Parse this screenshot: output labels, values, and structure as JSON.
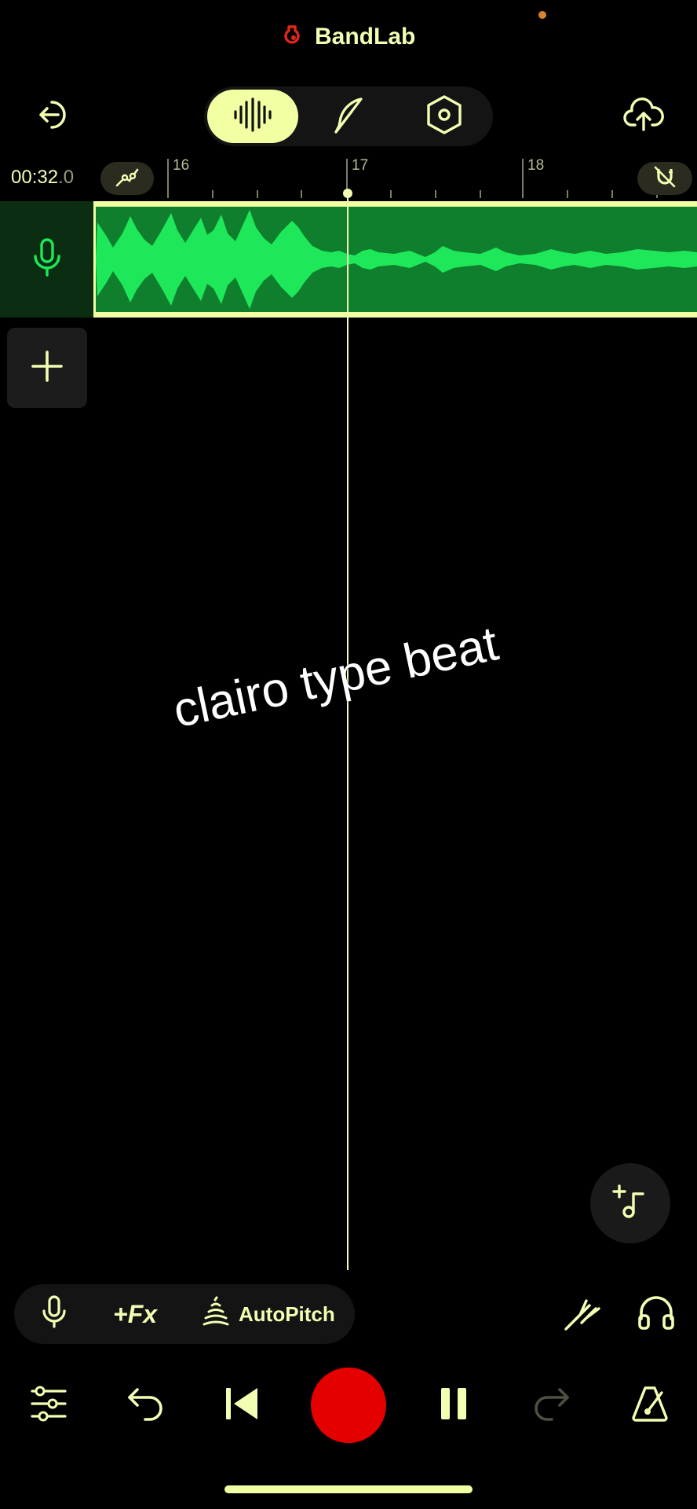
{
  "app": {
    "brand_name": "BandLab",
    "brand_color": "#e0261b"
  },
  "header": {
    "back_icon": "exit-icon",
    "modes": [
      {
        "name": "waveform-mode-icon",
        "active": true
      },
      {
        "name": "quill-mode-icon",
        "active": false
      },
      {
        "name": "settings-hex-icon",
        "active": false
      }
    ],
    "upload_icon": "cloud-upload-icon"
  },
  "timeline": {
    "time_main": "00:32",
    "time_fraction": ".0",
    "bars": [
      "16",
      "17",
      "18"
    ]
  },
  "track": {
    "type_icon": "microphone-icon",
    "region_color": "#0f7f2d",
    "wave_color": "#1ee85a"
  },
  "overlay": {
    "caption": "clairo type beat"
  },
  "toolbar": {
    "fx_label": "+Fx",
    "autopitch_label": "AutoPitch"
  },
  "colors": {
    "accent": "#f2ffa3",
    "background": "#000000",
    "record": "#e50000"
  }
}
